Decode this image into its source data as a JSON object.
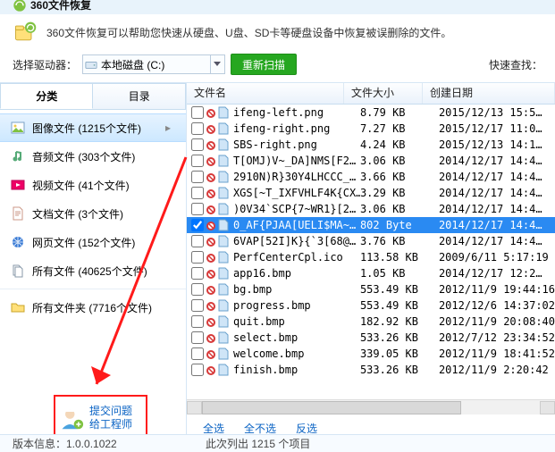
{
  "app": {
    "title": "360文件恢复"
  },
  "header": {
    "slogan": "360文件恢复可以帮助您快速从硬盘、U盘、SD卡等硬盘设备中恢复被误删除的文件。"
  },
  "toolbar": {
    "drive_label": "选择驱动器：",
    "drive_value": "本地磁盘 (C:)",
    "rescan": "重新扫描",
    "quick_search": "快速查找："
  },
  "left": {
    "tabs": {
      "cat": "分类",
      "dir": "目录"
    },
    "cats": [
      {
        "label": "图像文件 (1215个文件)"
      },
      {
        "label": "音频文件 (303个文件)"
      },
      {
        "label": "视频文件 (41个文件)"
      },
      {
        "label": "文档文件 (3个文件)"
      },
      {
        "label": "网页文件 (152个文件)"
      },
      {
        "label": "所有文件 (40625个文件)"
      },
      {
        "label": "所有文件夹 (7716个文件)"
      }
    ]
  },
  "help_box": {
    "line1": "提交问题",
    "line2": "给工程师"
  },
  "columns": {
    "name": "文件名",
    "size": "文件大小",
    "date": "创建日期"
  },
  "files": [
    {
      "name": "ifeng-left.png",
      "size": "8.79 KB",
      "date": "2015/12/13 15:5…",
      "sel": false
    },
    {
      "name": "ifeng-right.png",
      "size": "7.27 KB",
      "date": "2015/12/17 11:0…",
      "sel": false
    },
    {
      "name": "SBS-right.png",
      "size": "4.24 KB",
      "date": "2015/12/13 14:1…",
      "sel": false
    },
    {
      "name": "T[OMJ)V~_DA]NMS[F2…",
      "size": "3.06 KB",
      "date": "2014/12/17 14:4…",
      "sel": false
    },
    {
      "name": "2910N)R}30Y4LHCCC_…",
      "size": "3.66 KB",
      "date": "2014/12/17 14:4…",
      "sel": false
    },
    {
      "name": "XGS[~T_IXFVHLF4K{CX…",
      "size": "3.29 KB",
      "date": "2014/12/17 14:4…",
      "sel": false
    },
    {
      "name": ")0V34`SCP{7~WR1}[2…",
      "size": "3.06 KB",
      "date": "2014/12/17 14:4…",
      "sel": false
    },
    {
      "name": "0_AF{PJAA[UELI$MA~…",
      "size": "802 Byte",
      "date": "2014/12/17 14:4…",
      "sel": true
    },
    {
      "name": "6VAP[52I]K}{`3[68@…",
      "size": "3.76 KB",
      "date": "2014/12/17 14:4…",
      "sel": false
    },
    {
      "name": "PerfCenterCpl.ico",
      "size": "113.58 KB",
      "date": "2009/6/11 5:17:19",
      "sel": false
    },
    {
      "name": "app16.bmp",
      "size": "1.05 KB",
      "date": "2014/12/17 12:2…",
      "sel": false
    },
    {
      "name": "bg.bmp",
      "size": "553.49 KB",
      "date": "2012/11/9 19:44:16",
      "sel": false
    },
    {
      "name": "progress.bmp",
      "size": "553.49 KB",
      "date": "2012/12/6 14:37:02",
      "sel": false
    },
    {
      "name": "quit.bmp",
      "size": "182.92 KB",
      "date": "2012/11/9 20:08:40",
      "sel": false
    },
    {
      "name": "select.bmp",
      "size": "533.26 KB",
      "date": "2012/7/12 23:34:52",
      "sel": false
    },
    {
      "name": "welcome.bmp",
      "size": "339.05 KB",
      "date": "2012/11/9 18:41:52",
      "sel": false
    },
    {
      "name": "finish.bmp",
      "size": "533.26 KB",
      "date": "2012/11/9 2:20:42",
      "sel": false
    }
  ],
  "select_bar": {
    "all": "全选",
    "none": "全不选",
    "invert": "反选"
  },
  "status": {
    "version_label": "版本信息：1.0.0.1022",
    "summary": "此次列出 1215 个项目"
  },
  "icons": {
    "state_bad": "#d73a3a",
    "file_fill": "#cfe5f7",
    "file_stroke": "#6aa1cc"
  }
}
